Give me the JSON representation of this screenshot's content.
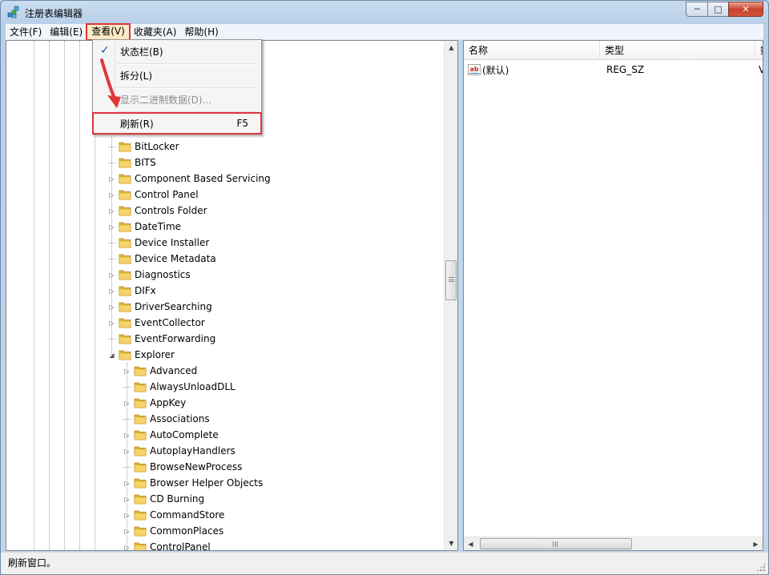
{
  "window": {
    "title": "注册表编辑器",
    "caption": {
      "minimize": "─",
      "maximize": "□",
      "close": "✕"
    }
  },
  "menubar": {
    "items": [
      {
        "label": "文件(F)",
        "active": false
      },
      {
        "label": "编辑(E)",
        "active": false
      },
      {
        "label": "查看(V)",
        "active": true
      },
      {
        "label": "收藏夹(A)",
        "active": false
      },
      {
        "label": "帮助(H)",
        "active": false
      }
    ]
  },
  "view_menu": {
    "items": [
      {
        "label": "状态栏(B)",
        "checked": true,
        "disabled": false,
        "shortcut": ""
      },
      {
        "label": "拆分(L)",
        "checked": false,
        "disabled": false,
        "shortcut": ""
      },
      {
        "label": "显示二进制数据(D)...",
        "checked": false,
        "disabled": true,
        "shortcut": ""
      },
      {
        "label": "刷新(R)",
        "checked": false,
        "disabled": false,
        "shortcut": "F5"
      }
    ],
    "check_glyph": "✓"
  },
  "tree": {
    "level1": [
      {
        "label": "BitLocker",
        "expander": ""
      },
      {
        "label": "BITS",
        "expander": ""
      },
      {
        "label": "Component Based Servicing",
        "expander": "▷"
      },
      {
        "label": "Control Panel",
        "expander": "▷"
      },
      {
        "label": "Controls Folder",
        "expander": "▷"
      },
      {
        "label": "DateTime",
        "expander": "▷"
      },
      {
        "label": "Device Installer",
        "expander": ""
      },
      {
        "label": "Device Metadata",
        "expander": ""
      },
      {
        "label": "Diagnostics",
        "expander": "▷"
      },
      {
        "label": "DIFx",
        "expander": "▷"
      },
      {
        "label": "DriverSearching",
        "expander": "▷"
      },
      {
        "label": "EventCollector",
        "expander": "▷"
      },
      {
        "label": "EventForwarding",
        "expander": ""
      },
      {
        "label": "Explorer",
        "expander": "◢"
      }
    ],
    "level2": [
      {
        "label": "Advanced",
        "expander": "▷"
      },
      {
        "label": "AlwaysUnloadDLL",
        "expander": ""
      },
      {
        "label": "AppKey",
        "expander": "▷"
      },
      {
        "label": "Associations",
        "expander": ""
      },
      {
        "label": "AutoComplete",
        "expander": "▷"
      },
      {
        "label": "AutoplayHandlers",
        "expander": "▷"
      },
      {
        "label": "BrowseNewProcess",
        "expander": ""
      },
      {
        "label": "Browser Helper Objects",
        "expander": "▷"
      },
      {
        "label": "CD Burning",
        "expander": "▷"
      },
      {
        "label": "CommandStore",
        "expander": "▷"
      },
      {
        "label": "CommonPlaces",
        "expander": "▷"
      },
      {
        "label": "ControlPanel",
        "expander": "▷"
      }
    ]
  },
  "list": {
    "columns": [
      "名称",
      "类型",
      "数"
    ],
    "rows": [
      {
        "icon": "ab",
        "name": "(默认)",
        "type": "REG_SZ",
        "data": "V"
      }
    ]
  },
  "scrollbars": {
    "up": "▲",
    "down": "▼",
    "left": "◀",
    "right": "▶"
  },
  "status": {
    "text": "刷新窗口。"
  },
  "colors": {
    "highlight_red": "#e0373b",
    "window_frame": "#c2d6ec"
  }
}
